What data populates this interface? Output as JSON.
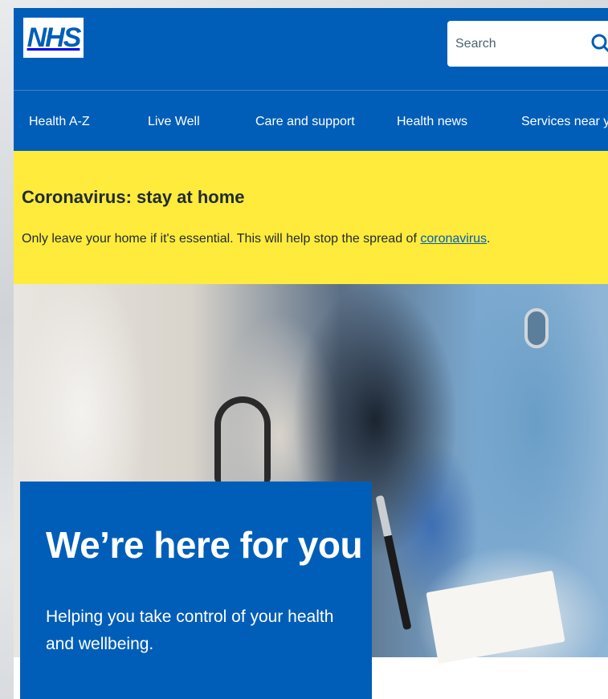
{
  "header": {
    "logo_text": "NHS",
    "search_placeholder": "Search",
    "search_icon": "search-icon"
  },
  "nav": {
    "items": [
      {
        "label": "Health A-Z"
      },
      {
        "label": "Live Well"
      },
      {
        "label": "Care and support"
      },
      {
        "label": "Health news"
      },
      {
        "label": "Services near you"
      }
    ]
  },
  "alert": {
    "title": "Coronavirus: stay at home",
    "text_before_link": "Only leave your home if it's essential. This will help stop the spread of ",
    "link_text": "coronavirus",
    "text_after_link": "."
  },
  "hero": {
    "title": "We’re here for you",
    "subtitle": "Helping you take control of your health and wellbeing."
  },
  "colors": {
    "brand_blue": "#005eb8",
    "alert_yellow": "#ffeb3b",
    "text_dark": "#212b32"
  }
}
